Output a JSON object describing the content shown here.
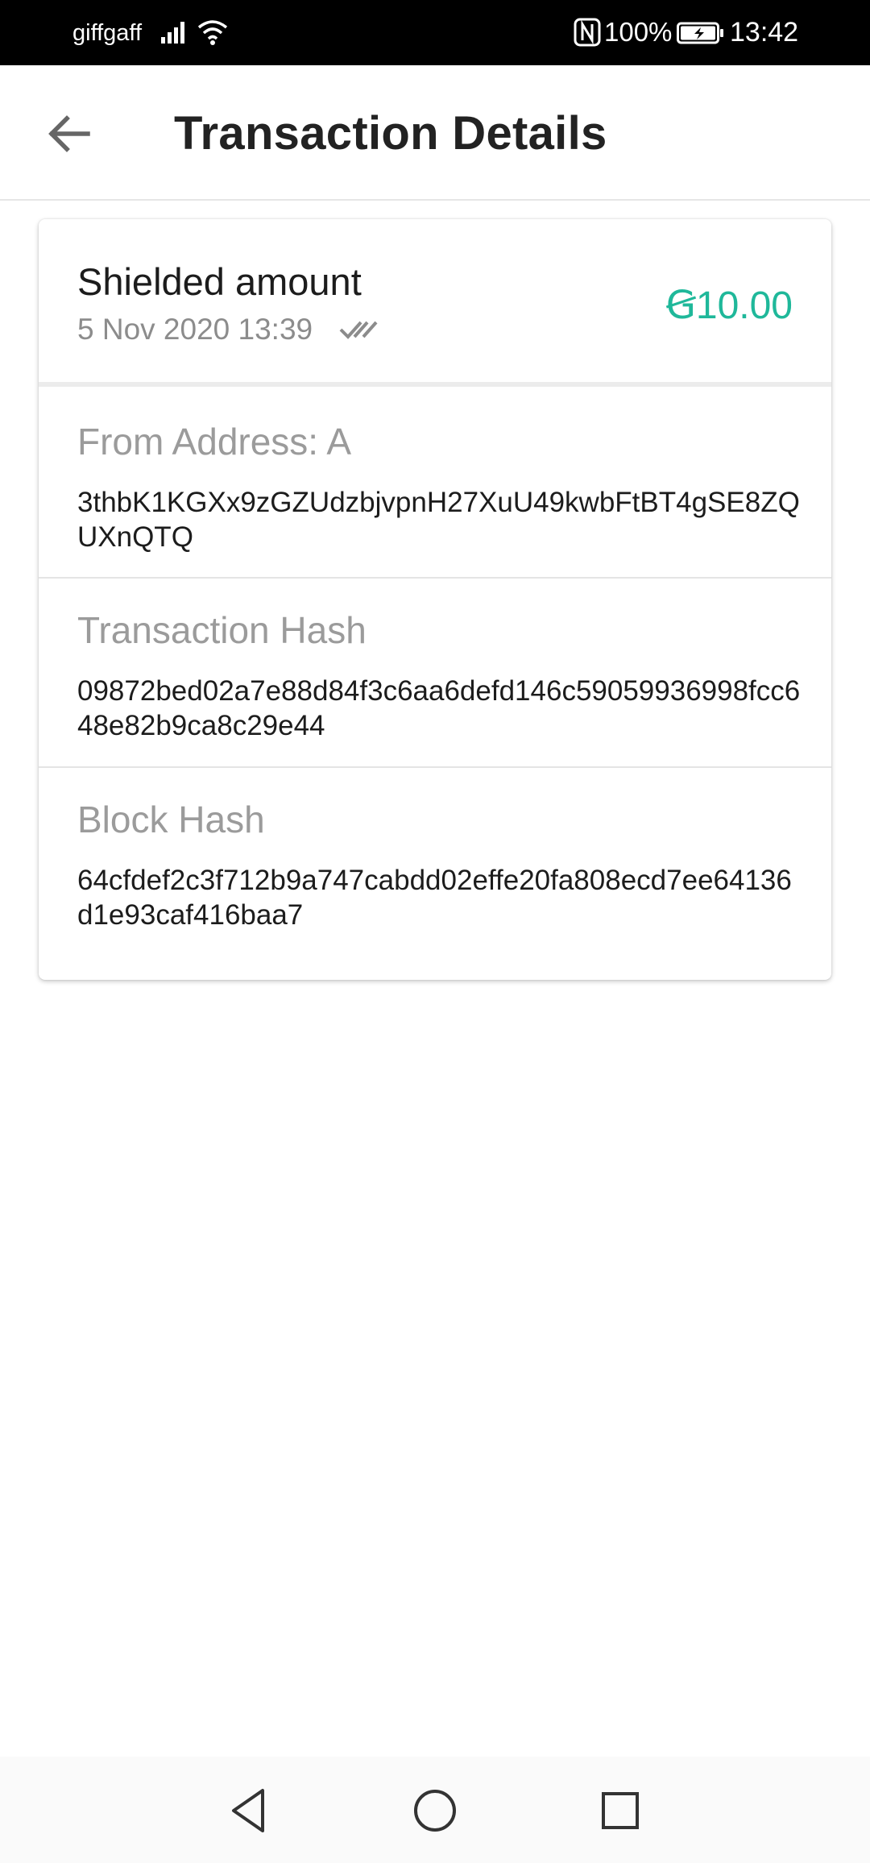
{
  "status_bar": {
    "carrier": "giffgaff",
    "battery_percent": "100%",
    "time": "13:42"
  },
  "header": {
    "title": "Transaction Details"
  },
  "transaction": {
    "type": "Shielded amount",
    "datetime": "5 Nov 2020 13:39",
    "amount": "Ꞡ10.00",
    "amount_color": "#1fb89a",
    "status_icon": "double-check-icon"
  },
  "details": [
    {
      "label": "From Address: A",
      "value": "3thbK1KGXx9zGZUdzbjvpnH27XuU49kwbFtBT4gSE8ZQUXnQTQ"
    },
    {
      "label": "Transaction Hash",
      "value": "09872bed02a7e88d84f3c6aa6defd146c59059936998fcc648e82b9ca8c29e44"
    },
    {
      "label": "Block Hash",
      "value": "64cfdef2c3f712b9a747cabdd02effe20fa808ecd7ee64136d1e93caf416baa7"
    }
  ],
  "nav_bar": {
    "buttons": [
      "back-triangle-icon",
      "home-circle-icon",
      "recents-square-icon"
    ]
  }
}
